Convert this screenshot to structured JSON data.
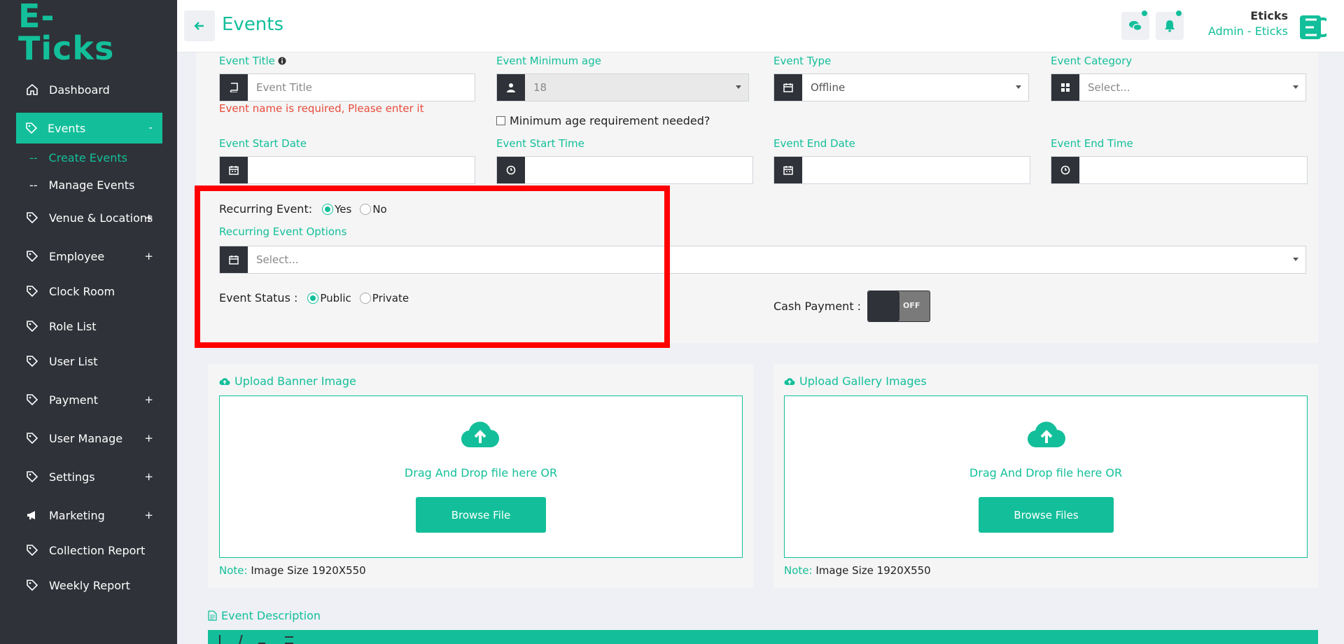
{
  "brand": {
    "logo_text": "E-Ticks",
    "accent": "#13bf9a",
    "sidebar_bg": "#2f3238"
  },
  "sidebar": {
    "items": [
      {
        "label": "Dashboard",
        "icon": "home-icon",
        "plus": ""
      },
      {
        "label": "Events",
        "icon": "tag-icon",
        "plus": "-"
      },
      {
        "label": "Venue & Locations",
        "icon": "tag-icon",
        "plus": "+"
      },
      {
        "label": "Employee",
        "icon": "tag-icon",
        "plus": "+"
      },
      {
        "label": "Clock Room",
        "icon": "tag-icon",
        "plus": ""
      },
      {
        "label": "Role List",
        "icon": "tag-icon",
        "plus": ""
      },
      {
        "label": "User List",
        "icon": "tag-icon",
        "plus": ""
      },
      {
        "label": "Payment",
        "icon": "tag-icon",
        "plus": "+"
      },
      {
        "label": "User Manage",
        "icon": "tag-icon",
        "plus": "+"
      },
      {
        "label": "Settings",
        "icon": "tag-icon",
        "plus": "+"
      },
      {
        "label": "Marketing",
        "icon": "megaphone-icon",
        "plus": "+"
      },
      {
        "label": "Collection Report",
        "icon": "tag-icon",
        "plus": ""
      },
      {
        "label": "Weekly Report",
        "icon": "tag-icon",
        "plus": ""
      }
    ],
    "sub_items": [
      {
        "prefix": "--",
        "label": "Create Events"
      },
      {
        "prefix": "--",
        "label": "Manage Events"
      }
    ]
  },
  "header": {
    "title": "Events",
    "user_name": "Eticks",
    "user_role": "Admin - Eticks"
  },
  "form": {
    "event_title": {
      "label": "Event Title",
      "placeholder": "Event Title",
      "error": "Event name is required, Please enter it"
    },
    "min_age": {
      "label": "Event Minimum age",
      "value": "18",
      "checkbox_label": "Minimum age requirement needed?"
    },
    "event_type": {
      "label": "Event Type",
      "value": "Offline"
    },
    "event_category": {
      "label": "Event Category",
      "value": "Select..."
    },
    "start_date": {
      "label": "Event Start Date",
      "value": ""
    },
    "start_time": {
      "label": "Event Start Time",
      "value": ""
    },
    "end_date": {
      "label": "Event End Date",
      "value": ""
    },
    "end_time": {
      "label": "Event End Time",
      "value": ""
    },
    "recurring": {
      "label": "Recurring Event:",
      "yes": "Yes",
      "no": "No",
      "selected": "Yes"
    },
    "recurring_options": {
      "label": "Recurring Event Options",
      "value": "Select..."
    },
    "status": {
      "label": "Event Status :",
      "public": "Public",
      "private": "Private",
      "selected": "Public"
    },
    "cash_payment": {
      "label": "Cash Payment :",
      "state": "OFF"
    }
  },
  "uploads": {
    "banner": {
      "title": "Upload Banner Image",
      "drop_text": "Drag And Drop file here OR",
      "button": "Browse File",
      "note_key": "Note:",
      "note_value": "Image Size 1920X550"
    },
    "gallery": {
      "title": "Upload Gallery Images",
      "drop_text": "Drag And Drop file here OR",
      "button": "Browse Files",
      "note_key": "Note:",
      "note_value": "Image Size 1920X550"
    }
  },
  "description": {
    "title": "Event Description"
  }
}
